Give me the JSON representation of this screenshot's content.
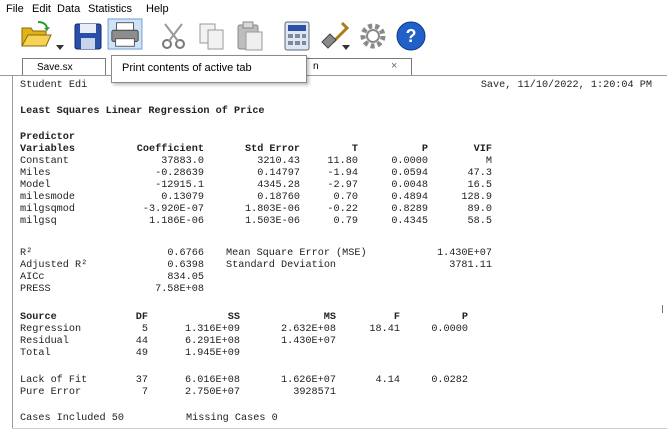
{
  "menu": [
    "File",
    "Edit",
    "Data",
    "Statistics",
    "Help"
  ],
  "tabs": {
    "tab1_label": "Save.sx",
    "tab2_fragment": "n",
    "tab2_close": "×"
  },
  "tooltip": "Print contents of active tab",
  "report": {
    "header_left": "Student Edi",
    "header_right": "Save, 11/10/2022, 1:20:04 PM",
    "title": "Least Squares Linear Regression of Price",
    "predictor_label": "Predictor",
    "coef_headers": [
      "Variables",
      "Coefficient",
      "Std Error",
      "T",
      "P",
      "VIF"
    ],
    "coef_rows": [
      [
        "Constant",
        "37883.0",
        "3210.43",
        "11.80",
        "0.0000",
        "M"
      ],
      [
        "Miles",
        "-0.28639",
        "0.14797",
        "-1.94",
        "0.0594",
        "47.3"
      ],
      [
        "Model",
        "-12915.1",
        "4345.28",
        "-2.97",
        "0.0048",
        "16.5"
      ],
      [
        "milesmode",
        "0.13079",
        "0.18760",
        "0.70",
        "0.4894",
        "128.9"
      ],
      [
        "milgsqmod",
        "-3.920E-07",
        "1.803E-06",
        "-0.22",
        "0.8289",
        "89.0"
      ],
      [
        "milgsq",
        "1.186E-06",
        "1.503E-06",
        "0.79",
        "0.4345",
        "58.5"
      ]
    ],
    "fit": {
      "r2_label": "R²",
      "r2": "0.6766",
      "adj_label": "Adjusted R²",
      "adj": "0.6398",
      "aicc_label": "AICc",
      "aicc": "834.05",
      "press_label": "PRESS",
      "press": "7.58E+08",
      "mse_label": "Mean Square Error (MSE)",
      "mse": "1.430E+07",
      "sd_label": "Standard Deviation",
      "sd": "3781.11"
    },
    "anova_headers": [
      "Source",
      "DF",
      "SS",
      "MS",
      "F",
      "P"
    ],
    "anova_rows": [
      [
        "Regression",
        "5",
        "1.316E+09",
        "2.632E+08",
        "18.41",
        "0.0000"
      ],
      [
        "Residual",
        "44",
        "6.291E+08",
        "1.430E+07",
        "",
        ""
      ],
      [
        "Total",
        "49",
        "1.945E+09",
        "",
        "",
        ""
      ]
    ],
    "lack_rows": [
      [
        "Lack of Fit",
        "37",
        "6.016E+08",
        "1.626E+07",
        "4.14",
        "0.0282"
      ],
      [
        "Pure Error",
        "7",
        "2.750E+07",
        "3928571",
        "",
        ""
      ]
    ],
    "cases_included_label": "Cases Included 50",
    "missing_cases_label": "Missing Cases 0"
  }
}
